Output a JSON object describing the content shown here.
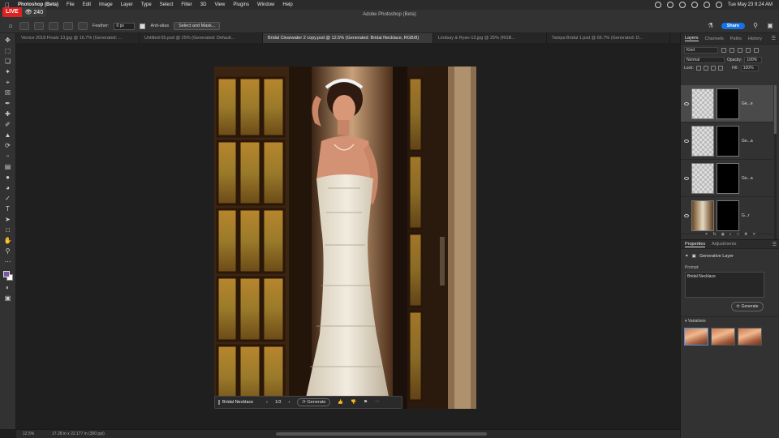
{
  "menubar": {
    "app_name": "Photoshop (Beta)",
    "items": [
      "File",
      "Edit",
      "Image",
      "Layer",
      "Type",
      "Select",
      "Filter",
      "3D",
      "View",
      "Plugins",
      "Window",
      "Help"
    ],
    "clock": "Tue May 23  9:24 AM"
  },
  "live_badge": {
    "label": "LIVE",
    "viewers": "240"
  },
  "window": {
    "title": "Adobe Photoshop (Beta)"
  },
  "options": {
    "feather_label": "Feather:",
    "feather_value": "0 px",
    "antialias_label": "Anti-alias",
    "select_mask_label": "Select and Mask...",
    "share_label": "Share"
  },
  "tabs": [
    {
      "label": "Venice 2018 Finals 13.jpg @ 16.7% (Generated: ...",
      "active": false
    },
    {
      "label": "Untitled-55.psd @ 25% (Generated: Default...",
      "active": false
    },
    {
      "label": "Bridal Clearwater 2 copy.psd @ 12.5% (Generated: Bridal Necklace, RGB/8)",
      "active": true
    },
    {
      "label": "Lindsay & Ryan-13.jpg @ 25% (RGB...",
      "active": false
    },
    {
      "label": "Tampa Bridal 1.psd @ 66.7% (Generated: D...",
      "active": false
    }
  ],
  "taskbar": {
    "prompt": "Bridal Necklace",
    "page": "1/3",
    "generate_label": "Generate"
  },
  "status": {
    "zoom": "12.5%",
    "doc_size": "17.28 in x 22.177 in (300 ppi)"
  },
  "layers_panel": {
    "tabs": [
      "Layers",
      "Channels",
      "Paths",
      "History"
    ],
    "filter_value": "Kind",
    "blend_mode": "Normal",
    "opacity_label": "Opacity:",
    "opacity_value": "100%",
    "lock_label": "Lock:",
    "fill_label": "Fill:",
    "fill_value": "100%",
    "layers": [
      {
        "name": "Ge...e",
        "selected": true
      },
      {
        "name": "Ge...a",
        "selected": false
      },
      {
        "name": "Ge...a",
        "selected": false
      },
      {
        "name": "G...r",
        "selected": false
      }
    ]
  },
  "properties_panel": {
    "tabs": [
      "Properties",
      "Adjustments"
    ],
    "layer_type": "Generative Layer",
    "prompt_label": "Prompt:",
    "prompt_value": "Bridal Necklace",
    "generate_label": "Generate",
    "variations_label": "Variations"
  },
  "colors": {
    "accent": "#1473e6",
    "live_red": "#dd2222",
    "foreground_swatch": "#7a5a9e"
  }
}
